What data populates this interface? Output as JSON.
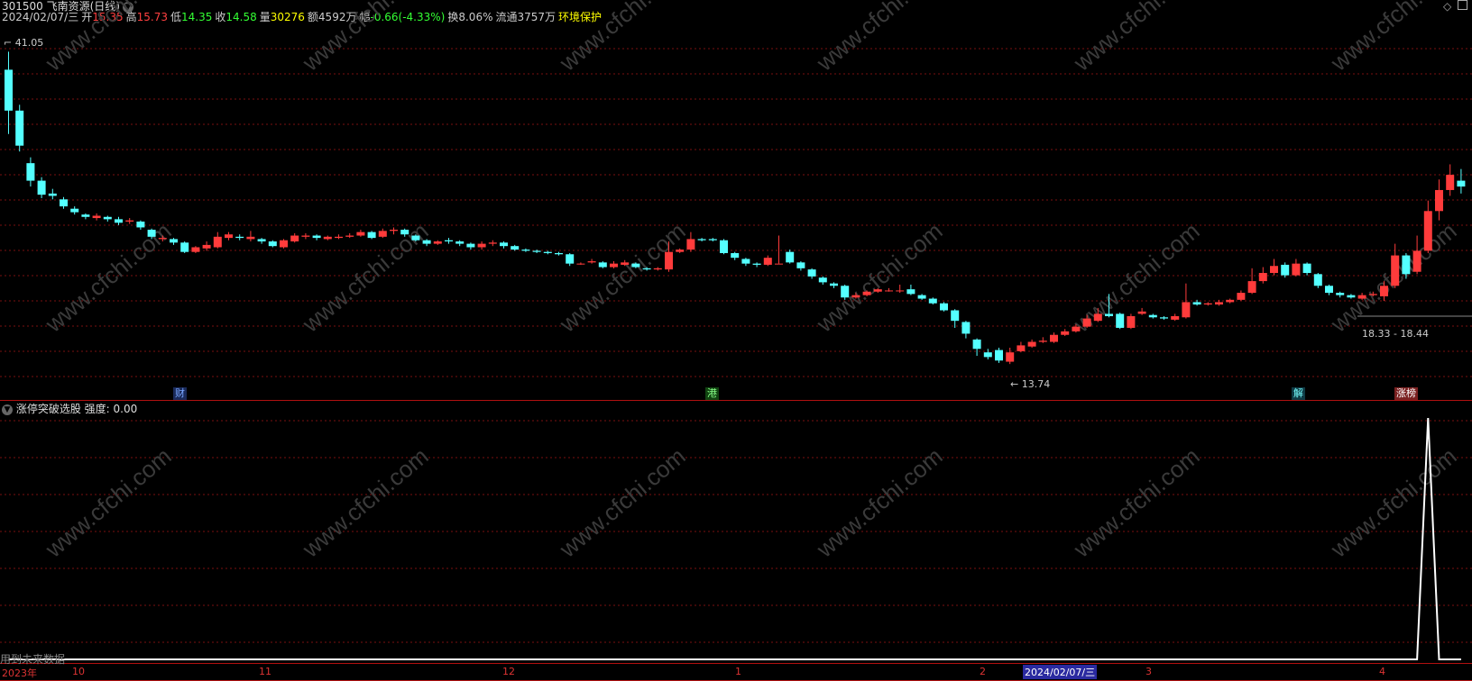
{
  "header": {
    "code_name": "301500 飞南资源(日线)",
    "date": "2024/02/07/三",
    "open_label": "开",
    "open": "15.35",
    "high_label": "高",
    "high": "15.73",
    "low_label": "低",
    "low": "14.35",
    "close_label": "收",
    "close": "14.58",
    "vol_label": "量",
    "vol": "30276",
    "amount": "额4592万",
    "change_label": "幅",
    "change": "-0.66(-4.33%)",
    "turnover": "换8.06%",
    "float": "流通3757万",
    "sector": "环境保护"
  },
  "price_annotations": {
    "high_mark": "41.05",
    "low_mark": "13.74",
    "range_mark": "18.33 - 18.44"
  },
  "event_markers": [
    {
      "label": "财",
      "color": "#7aa7ff",
      "bg": "#1a2a5a"
    },
    {
      "label": "港",
      "color": "#8f8",
      "bg": "#114411"
    },
    {
      "label": "解",
      "color": "#7ff",
      "bg": "#0e3a44"
    },
    {
      "label": "涨榜",
      "color": "#fff",
      "bg": "#7a2020"
    }
  ],
  "indicator": {
    "title": "涨停突破选股",
    "strength_label": "强度:",
    "strength_value": "0.00",
    "footer_note": "用到未来数据"
  },
  "watermark": "www.cfchi.com",
  "time_axis": {
    "year": "2023年",
    "months": [
      "10",
      "11",
      "12",
      "1",
      "2",
      "3",
      "4"
    ],
    "cursor_date": "2024/02/07/三"
  },
  "colors": {
    "up": "#ff3b3b",
    "down": "#54ffff",
    "grid": "#7a1010",
    "white": "#ffffff"
  },
  "chart_data": {
    "type": "candlestick",
    "price_range": [
      13.0,
      42.0
    ],
    "candles": [
      [
        39.5,
        36.0,
        41.05,
        34.0
      ],
      [
        36.0,
        33.0,
        36.5,
        32.5
      ],
      [
        31.5,
        30.0,
        32.0,
        29.5
      ],
      [
        30.0,
        28.8,
        30.3,
        28.5
      ],
      [
        28.9,
        28.7,
        29.3,
        28.4
      ],
      [
        28.4,
        27.8,
        28.6,
        27.6
      ],
      [
        27.6,
        27.3,
        27.8,
        27.1
      ],
      [
        27.1,
        26.9,
        27.2,
        26.7
      ],
      [
        26.8,
        27.0,
        27.2,
        26.6
      ],
      [
        26.9,
        26.7,
        27.0,
        26.5
      ],
      [
        26.7,
        26.4,
        26.9,
        26.2
      ],
      [
        26.5,
        26.6,
        26.8,
        26.3
      ],
      [
        26.5,
        26.0,
        26.6,
        25.8
      ],
      [
        25.8,
        25.2,
        25.9,
        25.0
      ],
      [
        25.0,
        25.1,
        25.3,
        24.8
      ],
      [
        25.0,
        24.7,
        25.1,
        24.5
      ],
      [
        24.7,
        23.9,
        24.8,
        23.8
      ],
      [
        23.9,
        24.3,
        24.4,
        23.8
      ],
      [
        24.2,
        24.5,
        24.8,
        24.0
      ],
      [
        24.3,
        25.2,
        25.6,
        24.2
      ],
      [
        25.1,
        25.4,
        25.6,
        24.9
      ],
      [
        25.2,
        25.1,
        25.4,
        24.9
      ],
      [
        25.0,
        25.2,
        25.7,
        24.8
      ],
      [
        25.0,
        24.8,
        25.1,
        24.6
      ],
      [
        24.8,
        24.4,
        24.9,
        24.3
      ],
      [
        24.3,
        24.9,
        25.0,
        24.2
      ],
      [
        24.8,
        25.3,
        25.5,
        24.7
      ],
      [
        25.2,
        25.3,
        25.5,
        25.0
      ],
      [
        25.3,
        25.1,
        25.4,
        24.9
      ],
      [
        25.0,
        25.2,
        25.3,
        24.9
      ],
      [
        25.1,
        25.2,
        25.4,
        25.0
      ],
      [
        25.2,
        25.3,
        25.5,
        25.1
      ],
      [
        25.3,
        25.6,
        25.8,
        25.2
      ],
      [
        25.6,
        25.1,
        25.7,
        25.0
      ],
      [
        25.2,
        25.7,
        25.9,
        25.1
      ],
      [
        25.7,
        25.8,
        26.0,
        25.4
      ],
      [
        25.8,
        25.4,
        25.9,
        25.2
      ],
      [
        25.3,
        24.9,
        25.4,
        24.8
      ],
      [
        24.9,
        24.6,
        25.0,
        24.4
      ],
      [
        24.6,
        24.8,
        24.9,
        24.5
      ],
      [
        24.9,
        24.8,
        25.1,
        24.6
      ],
      [
        24.8,
        24.6,
        24.9,
        24.4
      ],
      [
        24.6,
        24.3,
        24.7,
        24.1
      ],
      [
        24.3,
        24.6,
        24.8,
        24.1
      ],
      [
        24.6,
        24.7,
        24.9,
        24.4
      ],
      [
        24.7,
        24.4,
        24.8,
        24.2
      ],
      [
        24.4,
        24.1,
        24.5,
        24.0
      ],
      [
        24.1,
        24.0,
        24.2,
        23.9
      ],
      [
        24.0,
        23.9,
        24.1,
        23.8
      ],
      [
        23.9,
        23.8,
        24.0,
        23.7
      ],
      [
        23.8,
        23.7,
        23.9,
        23.6
      ],
      [
        23.7,
        22.9,
        23.8,
        22.7
      ],
      [
        22.9,
        22.9,
        23.0,
        22.8
      ],
      [
        23.0,
        23.1,
        23.3,
        22.9
      ],
      [
        23.0,
        22.6,
        23.1,
        22.5
      ],
      [
        22.6,
        22.9,
        23.1,
        22.5
      ],
      [
        22.8,
        23.0,
        23.2,
        22.7
      ],
      [
        22.9,
        22.6,
        23.0,
        22.5
      ],
      [
        22.5,
        22.4,
        22.6,
        22.3
      ],
      [
        22.4,
        22.5,
        22.6,
        22.3
      ],
      [
        22.4,
        23.9,
        24.8,
        22.2
      ],
      [
        23.9,
        24.1,
        24.2,
        23.8
      ],
      [
        24.1,
        25.0,
        25.6,
        23.9
      ],
      [
        25.0,
        24.9,
        25.1,
        24.8
      ],
      [
        25.0,
        24.9,
        25.1,
        24.8
      ],
      [
        24.9,
        23.8,
        25.0,
        23.7
      ],
      [
        23.8,
        23.4,
        23.9,
        23.2
      ],
      [
        23.3,
        22.9,
        23.4,
        22.7
      ],
      [
        22.9,
        22.8,
        23.0,
        22.6
      ],
      [
        22.8,
        23.4,
        23.6,
        22.7
      ],
      [
        22.9,
        22.9,
        25.3,
        22.9
      ],
      [
        23.9,
        23.0,
        24.1,
        22.9
      ],
      [
        23.0,
        22.5,
        23.1,
        22.3
      ],
      [
        22.4,
        21.8,
        22.5,
        21.6
      ],
      [
        21.7,
        21.3,
        21.8,
        21.1
      ],
      [
        21.2,
        21.0,
        21.3,
        20.8
      ],
      [
        21.0,
        20.0,
        21.1,
        19.8
      ],
      [
        20.0,
        20.2,
        20.4,
        19.9
      ],
      [
        20.2,
        20.5,
        20.6,
        20.1
      ],
      [
        20.5,
        20.7,
        20.8,
        20.4
      ],
      [
        20.6,
        20.6,
        20.8,
        20.5
      ],
      [
        20.6,
        20.6,
        21.1,
        20.4
      ],
      [
        20.7,
        20.3,
        21.1,
        20.2
      ],
      [
        20.2,
        19.9,
        20.3,
        19.8
      ],
      [
        19.9,
        19.5,
        20.0,
        19.4
      ],
      [
        19.5,
        18.9,
        19.6,
        18.8
      ],
      [
        18.9,
        18.0,
        19.0,
        17.4
      ],
      [
        17.9,
        16.9,
        18.0,
        16.5
      ],
      [
        16.4,
        15.6,
        16.5,
        15.0
      ],
      [
        15.3,
        14.9,
        15.6,
        14.7
      ],
      [
        15.5,
        14.6,
        15.7,
        14.4
      ],
      [
        14.5,
        15.3,
        15.7,
        14.3
      ],
      [
        15.4,
        15.9,
        16.2,
        15.3
      ],
      [
        15.8,
        16.2,
        16.4,
        15.7
      ],
      [
        16.2,
        16.3,
        16.6,
        16.1
      ],
      [
        16.2,
        16.8,
        17.0,
        16.1
      ],
      [
        16.8,
        17.1,
        17.3,
        16.7
      ],
      [
        17.1,
        17.5,
        17.7,
        17.0
      ],
      [
        17.5,
        18.2,
        18.5,
        17.4
      ],
      [
        18.0,
        18.6,
        19.1,
        17.9
      ],
      [
        18.6,
        18.4,
        20.3,
        18.3
      ],
      [
        18.6,
        17.4,
        18.7,
        17.3
      ],
      [
        17.4,
        18.4,
        18.6,
        17.3
      ],
      [
        18.6,
        18.8,
        19.1,
        18.5
      ],
      [
        18.5,
        18.3,
        18.6,
        18.2
      ],
      [
        18.3,
        18.2,
        18.4,
        18.1
      ],
      [
        18.1,
        18.4,
        18.6,
        18.0
      ],
      [
        18.3,
        19.6,
        21.2,
        18.2
      ],
      [
        19.6,
        19.4,
        19.8,
        19.3
      ],
      [
        19.4,
        19.5,
        19.6,
        19.3
      ],
      [
        19.4,
        19.6,
        19.8,
        19.3
      ],
      [
        19.6,
        19.8,
        19.9,
        19.5
      ],
      [
        19.8,
        20.4,
        20.6,
        19.7
      ],
      [
        20.4,
        21.4,
        22.5,
        20.3
      ],
      [
        21.4,
        22.1,
        22.6,
        21.2
      ],
      [
        22.1,
        22.7,
        23.3,
        21.9
      ],
      [
        22.8,
        21.9,
        23.0,
        21.7
      ],
      [
        21.9,
        22.9,
        23.3,
        21.8
      ],
      [
        22.9,
        22.1,
        23.0,
        21.9
      ],
      [
        22.0,
        21.0,
        22.1,
        20.8
      ],
      [
        21.0,
        20.4,
        21.1,
        20.2
      ],
      [
        20.4,
        20.2,
        20.5,
        20.0
      ],
      [
        20.2,
        20.0,
        20.3,
        19.9
      ],
      [
        19.9,
        20.2,
        20.4,
        19.8
      ],
      [
        20.2,
        20.3,
        20.5,
        20.1
      ],
      [
        20.1,
        21.0,
        21.4,
        19.7
      ],
      [
        21.0,
        23.6,
        24.6,
        20.8
      ],
      [
        23.6,
        22.0,
        23.8,
        21.6
      ],
      [
        22.2,
        24.0,
        25.3,
        22.0
      ],
      [
        24.0,
        27.4,
        28.3,
        23.8
      ],
      [
        27.4,
        29.2,
        30.1,
        26.6
      ],
      [
        29.2,
        30.5,
        31.4,
        28.7
      ],
      [
        30.0,
        29.5,
        31.0,
        28.9
      ]
    ],
    "indicator_series": {
      "name": "强度",
      "values": "0 for all bars except a spike of 1 at the 4th bar from the end"
    }
  }
}
